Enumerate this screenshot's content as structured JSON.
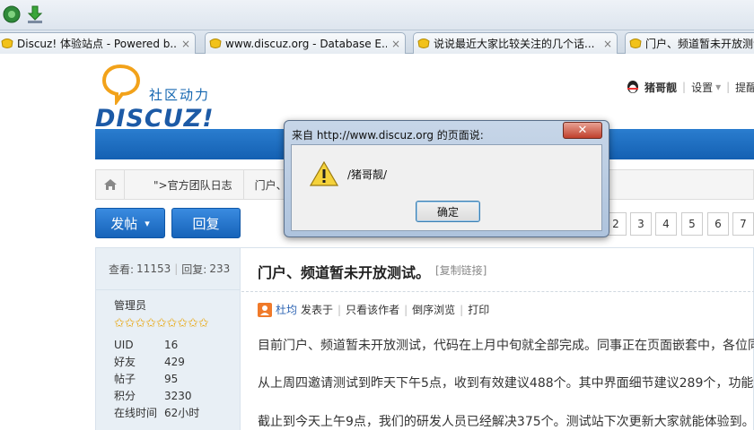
{
  "browser": {
    "tabs": [
      {
        "title": "Discuz! 体验站点 - Powered b...",
        "close": "×"
      },
      {
        "title": "www.discuz.org - Database E...",
        "close": "×"
      },
      {
        "title": "说说最近大家比较关注的几个话...",
        "close": "×"
      },
      {
        "title": "门户、频道暂未开放测试",
        "close": ""
      }
    ]
  },
  "site": {
    "slogan": "社区动力",
    "logo_text": "DISCUZ!",
    "user": {
      "name": "猪哥靓",
      "settings": "设置",
      "remind": "提醒"
    }
  },
  "breadcrumb": {
    "crumbs": [
      "\">官方团队日志",
      "门户、频"
    ]
  },
  "actions": {
    "post": "发帖",
    "post_arrow": "▾",
    "reply": "回复"
  },
  "pagination": {
    "pages": [
      "2",
      "3",
      "4",
      "5",
      "6",
      "7"
    ]
  },
  "thread": {
    "views_label": "查看:",
    "views": "11153",
    "replies_label": "回复:",
    "replies": "233",
    "title": "门户、频道暂未开放测试。",
    "copy_link": "[复制链接]",
    "author": "杜均",
    "posted_label": "发表于",
    "only_author": "只看该作者",
    "reverse": "倒序浏览",
    "print": "打印",
    "paragraphs": [
      "目前门户、频道暂未开放测试，代码在上月中旬就全部完成。同事正在页面嵌套中，各位同",
      "从上周四邀请测试到昨天下午5点，收到有效建议488个。其中界面细节建议289个，功能建",
      "截止到今天上午9点，我们的研发人员已经解决375个。测试站下次更新大家就能体验到。"
    ]
  },
  "profile": {
    "role": "管理员",
    "star_count": 9,
    "stats": [
      {
        "key": "UID",
        "value": "16"
      },
      {
        "key": "好友",
        "value": "429"
      },
      {
        "key": "帖子",
        "value": "95"
      },
      {
        "key": "积分",
        "value": "3230"
      },
      {
        "key": "在线时间",
        "value": "62小时"
      }
    ]
  },
  "dialog": {
    "title": "来自 http://www.discuz.org 的页面说:",
    "message": "/猪哥靓/",
    "ok": "确定",
    "close": "✕"
  },
  "colors": {
    "nav_blue": "#1868be",
    "star": "#e8a200",
    "link": "#2d64b3"
  }
}
